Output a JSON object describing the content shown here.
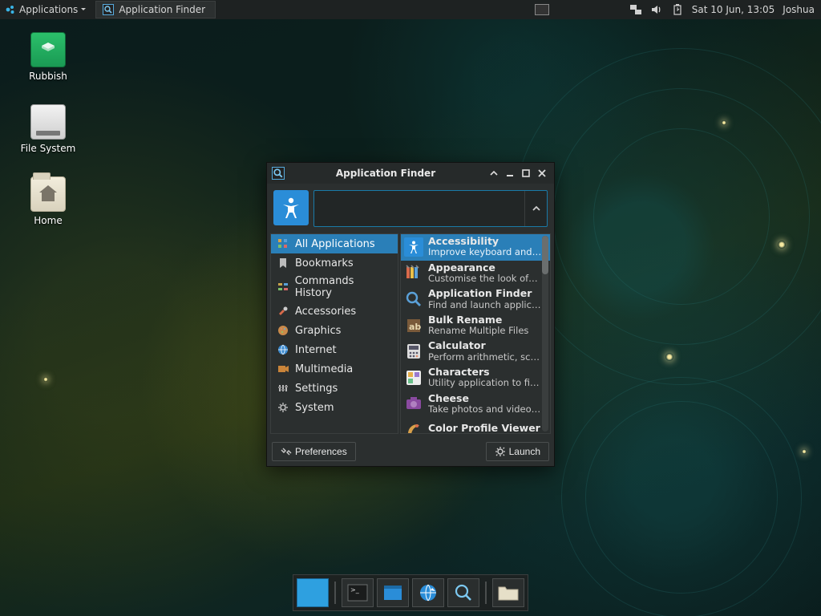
{
  "panel": {
    "applications_label": "Applications",
    "task_button_label": "Application Finder",
    "clock": "Sat 10 Jun, 13:05",
    "user": "Joshua"
  },
  "desktop": {
    "trash_label": "Rubbish",
    "filesystem_label": "File System",
    "home_label": "Home"
  },
  "window": {
    "title": "Application Finder",
    "search_value": "",
    "preferences_label": "Preferences",
    "launch_label": "Launch"
  },
  "categories": [
    {
      "label": "All Applications",
      "icon": "apps"
    },
    {
      "label": "Bookmarks",
      "icon": "bookmark"
    },
    {
      "label": "Commands History",
      "icon": "history"
    },
    {
      "label": "Accessories",
      "icon": "accessories"
    },
    {
      "label": "Graphics",
      "icon": "graphics"
    },
    {
      "label": "Internet",
      "icon": "internet"
    },
    {
      "label": "Multimedia",
      "icon": "multimedia"
    },
    {
      "label": "Settings",
      "icon": "settings"
    },
    {
      "label": "System",
      "icon": "system"
    }
  ],
  "apps": [
    {
      "title": "Accessibility",
      "desc": "Improve keyboard and…",
      "icon": "accessibility",
      "selected": true
    },
    {
      "title": "Appearance",
      "desc": "Customise the look of…",
      "icon": "appearance"
    },
    {
      "title": "Application Finder",
      "desc": "Find and launch applic…",
      "icon": "finder"
    },
    {
      "title": "Bulk Rename",
      "desc": "Rename Multiple Files",
      "icon": "rename"
    },
    {
      "title": "Calculator",
      "desc": "Perform arithmetic, sc…",
      "icon": "calc"
    },
    {
      "title": "Characters",
      "desc": "Utility application to fi…",
      "icon": "chars"
    },
    {
      "title": "Cheese",
      "desc": "Take photos and video…",
      "icon": "cheese"
    },
    {
      "title": "Color Profile Viewer",
      "desc": "",
      "icon": "color"
    }
  ],
  "dock": {
    "items": [
      "show-desktop",
      "terminal",
      "files",
      "browser",
      "finder",
      "folder"
    ]
  }
}
